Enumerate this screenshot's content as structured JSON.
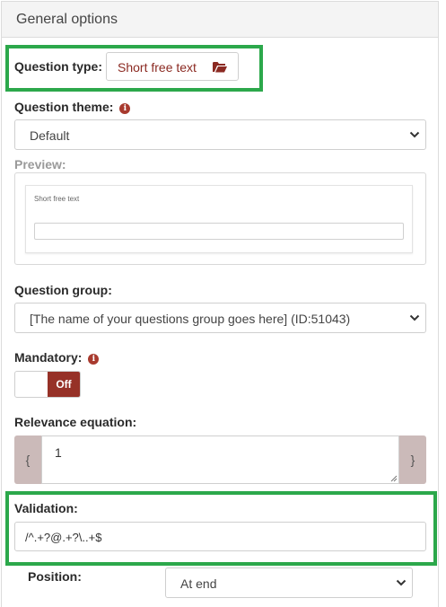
{
  "panel": {
    "title": "General options"
  },
  "question_type": {
    "label": "Question type:",
    "value": "Short free text",
    "icon": "folder-open-icon"
  },
  "question_theme": {
    "label": "Question theme:",
    "selected": "Default",
    "info_icon": "info-icon"
  },
  "preview": {
    "label": "Preview:",
    "question_text": "Short free text"
  },
  "question_group": {
    "label": "Question group:",
    "selected": "[The name of your questions group goes here] (ID:51043)"
  },
  "mandatory": {
    "label": "Mandatory:",
    "toggle_label": "Off",
    "info_icon": "info-icon"
  },
  "relevance": {
    "label": "Relevance equation:",
    "open_brace": "{",
    "close_brace": "}",
    "value": "1"
  },
  "validation": {
    "label": "Validation:",
    "value": "/^.+?@.+?\\..+$"
  },
  "position": {
    "label": "Position:",
    "selected": "At end"
  },
  "colors": {
    "highlight": "#2ca84b",
    "accent": "#963127",
    "text_accent": "#8b2a22"
  }
}
